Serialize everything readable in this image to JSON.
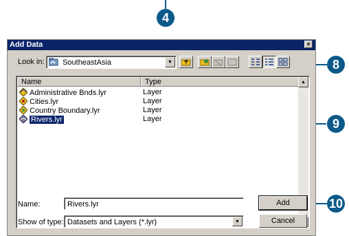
{
  "callouts": {
    "c4": "4",
    "c8": "8",
    "c9": "9",
    "c10": "10"
  },
  "dialog": {
    "title": "Add Data",
    "close_glyph": "×",
    "look_in_label": "Look in:",
    "look_in_value": "SoutheastAsia",
    "list": {
      "columns": [
        "Name",
        "Type"
      ],
      "rows": [
        {
          "name": "Administrative Bnds.lyr",
          "type": "Layer"
        },
        {
          "name": "Cities.lyr",
          "type": "Layer"
        },
        {
          "name": "Country Boundary.lyr",
          "type": "Layer"
        },
        {
          "name": "Rivers.lyr",
          "type": "Layer"
        }
      ]
    },
    "name_label": "Name:",
    "name_value": "Rivers.lyr",
    "type_label": "Show of type:",
    "type_value": "Datasets and Layers (*.lyr)",
    "add_label": "Add",
    "cancel_label": "Cancel"
  },
  "colors": {
    "callout": "#0b5a8a",
    "titlebar": "#0a246a",
    "dialog_bg": "#d4d0c8",
    "layer_icon": "#e8c020"
  }
}
